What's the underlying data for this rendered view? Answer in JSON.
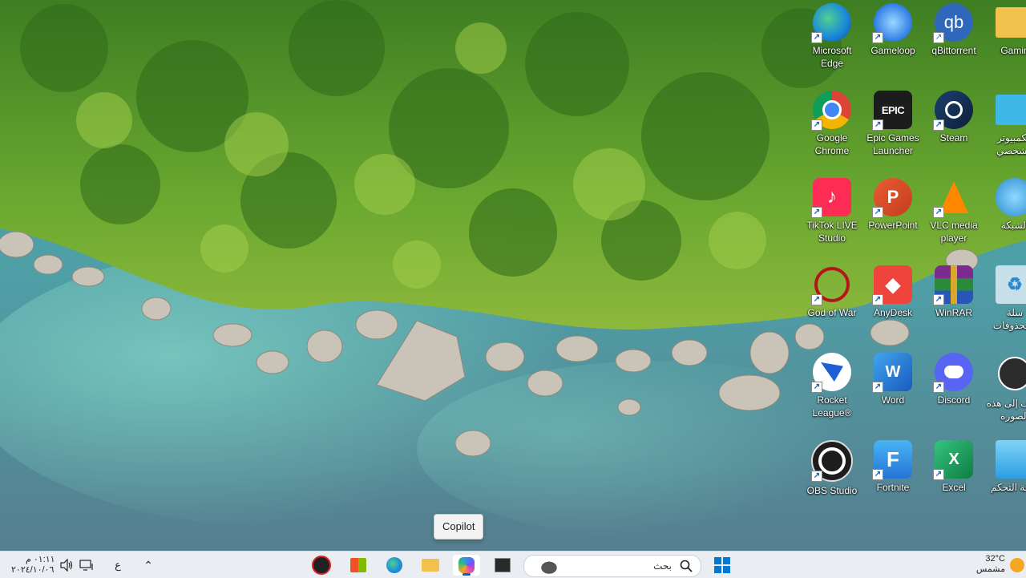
{
  "desktop": {
    "icons": [
      {
        "label": "Microsoft Edge",
        "icon": "edge-icon"
      },
      {
        "label": "Gameloop",
        "icon": "gameloop-icon"
      },
      {
        "label": "qBittorrent",
        "icon": "qbittorrent-icon",
        "glyph": "qb"
      },
      {
        "label": "Gamin",
        "icon": "folder-icon"
      },
      {
        "label": "Google Chrome",
        "icon": "chrome-icon"
      },
      {
        "label": "Epic Games Launcher",
        "icon": "epic-games-icon",
        "glyph": "EPIC"
      },
      {
        "label": "Steam",
        "icon": "steam-icon"
      },
      {
        "label": "الكمبيوتر الشخصي",
        "icon": "this-pc-icon"
      },
      {
        "label": "TikTok LIVE Studio",
        "icon": "tiktok-icon"
      },
      {
        "label": "PowerPoint",
        "icon": "powerpoint-icon",
        "glyph": "P"
      },
      {
        "label": "VLC media player",
        "icon": "vlc-icon"
      },
      {
        "label": "الشبكة",
        "icon": "network-icon"
      },
      {
        "label": "God of War",
        "icon": "god-of-war-icon"
      },
      {
        "label": "AnyDesk",
        "icon": "anydesk-icon"
      },
      {
        "label": "WinRAR",
        "icon": "winrar-icon"
      },
      {
        "label": "سلة المحذوفات",
        "icon": "recycle-bin-icon"
      },
      {
        "label": "Rocket League®",
        "icon": "rocket-league-icon"
      },
      {
        "label": "Word",
        "icon": "word-icon",
        "glyph": "W"
      },
      {
        "label": "Discord",
        "icon": "discord-icon"
      },
      {
        "label": "تعرف إلى هذه الصورة",
        "icon": "learn-about-picture-icon"
      },
      {
        "label": "OBS Studio",
        "icon": "obs-icon"
      },
      {
        "label": "Fortnite",
        "icon": "fortnite-icon",
        "glyph": "F"
      },
      {
        "label": "Excel",
        "icon": "excel-icon",
        "glyph": "X"
      },
      {
        "label": "لوحة التحكم",
        "icon": "control-panel-icon"
      }
    ]
  },
  "tooltip": {
    "text": "Copilot"
  },
  "taskbar": {
    "clock": {
      "time": "٠١:١١ م",
      "date": "٢٠٢٤/١٠/٠٦"
    },
    "language": "ع",
    "search": {
      "placeholder": "بحث"
    },
    "weather": {
      "temp": "32°C",
      "condition": "مشمس"
    },
    "apps": [
      "app-icon",
      "microsoft-store-icon",
      "edge-icon",
      "file-explorer-icon",
      "copilot-icon",
      "terminal-icon"
    ]
  },
  "colors": {
    "taskbar_bg": "#eaeef2",
    "accent": "#0067c0"
  }
}
